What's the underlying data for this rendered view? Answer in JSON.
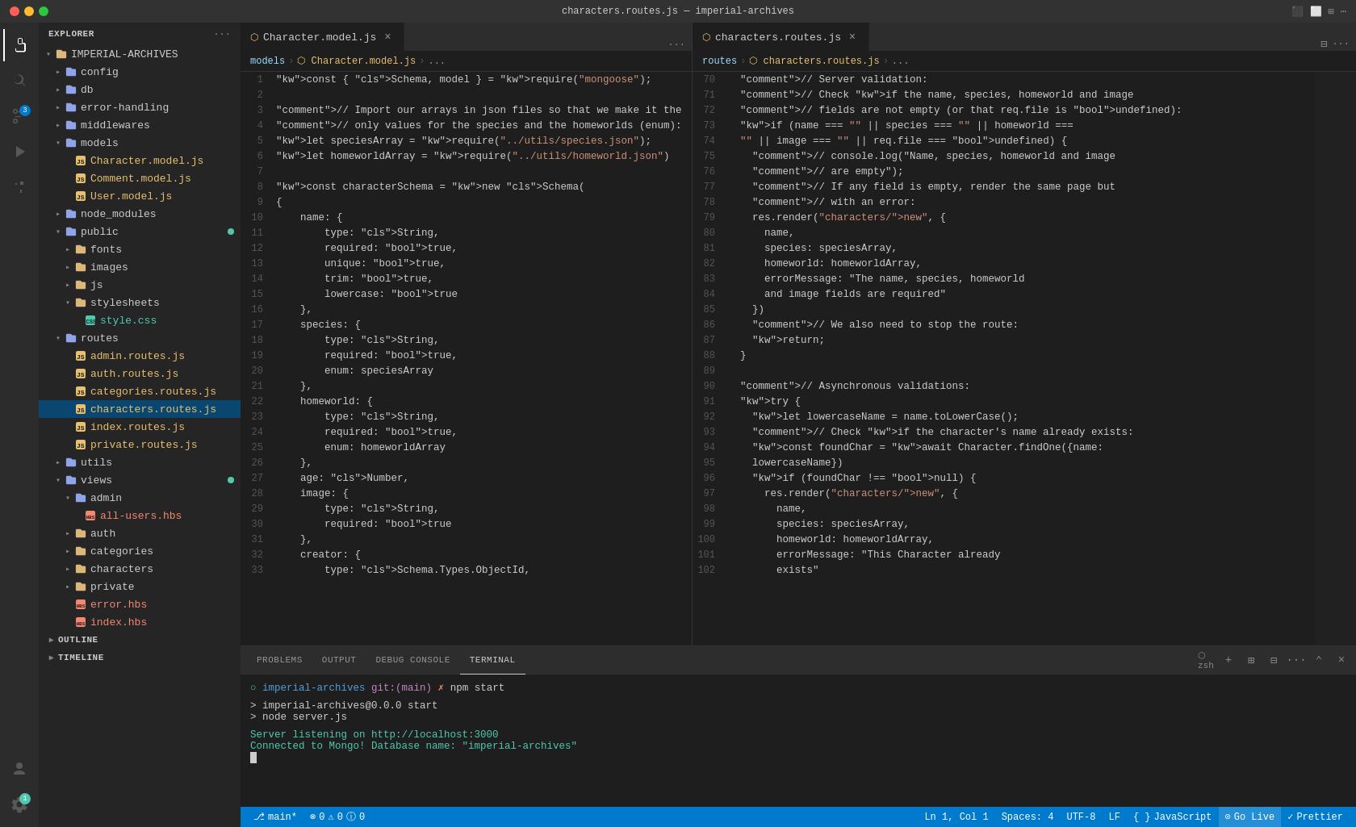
{
  "titleBar": {
    "title": "characters.routes.js — imperial-archives"
  },
  "activityBar": {
    "icons": [
      {
        "name": "explorer-icon",
        "symbol": "⎘",
        "active": true,
        "badge": null
      },
      {
        "name": "search-icon",
        "symbol": "🔍",
        "active": false,
        "badge": null
      },
      {
        "name": "source-control-icon",
        "symbol": "⎇",
        "active": false,
        "badge": "3"
      },
      {
        "name": "run-icon",
        "symbol": "▷",
        "active": false,
        "badge": null
      },
      {
        "name": "extensions-icon",
        "symbol": "⊞",
        "active": false,
        "badge": null
      }
    ],
    "bottomIcons": [
      {
        "name": "accounts-icon",
        "symbol": "👤"
      },
      {
        "name": "settings-icon",
        "symbol": "⚙",
        "badge": "1"
      }
    ]
  },
  "sidebar": {
    "title": "EXPLORER",
    "projectName": "IMPERIAL-ARCHIVES",
    "tree": [
      {
        "indent": 0,
        "type": "folder",
        "open": true,
        "label": "IMPERIAL-ARCHIVES",
        "color": "folder"
      },
      {
        "indent": 1,
        "type": "folder",
        "open": false,
        "label": "config",
        "color": "folder-blue"
      },
      {
        "indent": 1,
        "type": "folder",
        "open": false,
        "label": "db",
        "color": "folder-blue"
      },
      {
        "indent": 1,
        "type": "folder",
        "open": false,
        "label": "error-handling",
        "color": "folder-blue"
      },
      {
        "indent": 1,
        "type": "folder",
        "open": false,
        "label": "middlewares",
        "color": "folder-blue"
      },
      {
        "indent": 1,
        "type": "folder",
        "open": true,
        "label": "models",
        "color": "folder-blue"
      },
      {
        "indent": 2,
        "type": "file",
        "label": "Character.model.js",
        "color": "js"
      },
      {
        "indent": 2,
        "type": "file",
        "label": "Comment.model.js",
        "color": "js"
      },
      {
        "indent": 2,
        "type": "file",
        "label": "User.model.js",
        "color": "js"
      },
      {
        "indent": 1,
        "type": "folder",
        "open": false,
        "label": "node_modules",
        "color": "folder-blue"
      },
      {
        "indent": 1,
        "type": "folder",
        "open": true,
        "label": "public",
        "color": "folder-blue",
        "dot": true
      },
      {
        "indent": 2,
        "type": "folder",
        "open": false,
        "label": "fonts",
        "color": "folder"
      },
      {
        "indent": 2,
        "type": "folder",
        "open": false,
        "label": "images",
        "color": "folder"
      },
      {
        "indent": 2,
        "type": "folder",
        "open": false,
        "label": "js",
        "color": "folder"
      },
      {
        "indent": 2,
        "type": "folder",
        "open": true,
        "label": "stylesheets",
        "color": "folder"
      },
      {
        "indent": 3,
        "type": "file",
        "label": "style.css",
        "color": "css"
      },
      {
        "indent": 1,
        "type": "folder",
        "open": true,
        "label": "routes",
        "color": "folder-blue"
      },
      {
        "indent": 2,
        "type": "file",
        "label": "admin.routes.js",
        "color": "js"
      },
      {
        "indent": 2,
        "type": "file",
        "label": "auth.routes.js",
        "color": "js"
      },
      {
        "indent": 2,
        "type": "file",
        "label": "categories.routes.js",
        "color": "js"
      },
      {
        "indent": 2,
        "type": "file",
        "label": "characters.routes.js",
        "color": "js",
        "active": true
      },
      {
        "indent": 2,
        "type": "file",
        "label": "index.routes.js",
        "color": "js"
      },
      {
        "indent": 2,
        "type": "file",
        "label": "private.routes.js",
        "color": "js"
      },
      {
        "indent": 1,
        "type": "folder",
        "open": false,
        "label": "utils",
        "color": "folder-blue"
      },
      {
        "indent": 1,
        "type": "folder",
        "open": true,
        "label": "views",
        "color": "folder-blue",
        "dot": true
      },
      {
        "indent": 2,
        "type": "folder",
        "open": true,
        "label": "admin",
        "color": "folder-blue"
      },
      {
        "indent": 3,
        "type": "file",
        "label": "all-users.hbs",
        "color": "hbs"
      },
      {
        "indent": 2,
        "type": "folder",
        "open": false,
        "label": "auth",
        "color": "folder"
      },
      {
        "indent": 2,
        "type": "folder",
        "open": false,
        "label": "categories",
        "color": "folder"
      },
      {
        "indent": 2,
        "type": "folder",
        "open": false,
        "label": "characters",
        "color": "folder"
      },
      {
        "indent": 2,
        "type": "folder",
        "open": false,
        "label": "private",
        "color": "folder"
      },
      {
        "indent": 2,
        "type": "file",
        "label": "error.hbs",
        "color": "hbs"
      },
      {
        "indent": 2,
        "type": "file",
        "label": "index.hbs",
        "color": "hbs"
      }
    ],
    "outlineLabel": "OUTLINE",
    "timelineLabel": "TIMELINE"
  },
  "leftEditor": {
    "tab": {
      "icon": "js-icon",
      "label": "Character.model.js",
      "closable": true
    },
    "breadcrumb": [
      "models",
      "Character.model.js",
      "..."
    ],
    "lines": [
      {
        "num": 1,
        "code": "const { Schema, model } = require(\"mongoose\");"
      },
      {
        "num": 2,
        "code": ""
      },
      {
        "num": 3,
        "code": "// Import our arrays in json files so that we make it the"
      },
      {
        "num": 4,
        "code": "// only values for the species and the homeworlds (enum):"
      },
      {
        "num": 5,
        "code": "let speciesArray = require(\"../utils/species.json\");"
      },
      {
        "num": 6,
        "code": "let homeworldArray = require(\"../utils/homeworld.json\")"
      },
      {
        "num": 7,
        "code": ""
      },
      {
        "num": 8,
        "code": "const characterSchema = new Schema("
      },
      {
        "num": 9,
        "code": "{"
      },
      {
        "num": 10,
        "code": "    name: {"
      },
      {
        "num": 11,
        "code": "        type: String,"
      },
      {
        "num": 12,
        "code": "        required: true,"
      },
      {
        "num": 13,
        "code": "        unique: true,"
      },
      {
        "num": 14,
        "code": "        trim: true,"
      },
      {
        "num": 15,
        "code": "        lowercase: true"
      },
      {
        "num": 16,
        "code": "    },"
      },
      {
        "num": 17,
        "code": "    species: {"
      },
      {
        "num": 18,
        "code": "        type: String,"
      },
      {
        "num": 19,
        "code": "        required: true,"
      },
      {
        "num": 20,
        "code": "        enum: speciesArray"
      },
      {
        "num": 21,
        "code": "    },"
      },
      {
        "num": 22,
        "code": "    homeworld: {"
      },
      {
        "num": 23,
        "code": "        type: String,"
      },
      {
        "num": 24,
        "code": "        required: true,"
      },
      {
        "num": 25,
        "code": "        enum: homeworldArray"
      },
      {
        "num": 26,
        "code": "    },"
      },
      {
        "num": 27,
        "code": "    age: Number,"
      },
      {
        "num": 28,
        "code": "    image: {"
      },
      {
        "num": 29,
        "code": "        type: String,"
      },
      {
        "num": 30,
        "code": "        required: true"
      },
      {
        "num": 31,
        "code": "    },"
      },
      {
        "num": 32,
        "code": "    creator: {"
      },
      {
        "num": 33,
        "code": "        type: Schema.Types.ObjectId,"
      }
    ]
  },
  "rightEditor": {
    "tab": {
      "icon": "routes-icon",
      "label": "characters.routes.js",
      "closable": true
    },
    "breadcrumb": [
      "routes",
      "characters.routes.js",
      "..."
    ],
    "lines": [
      {
        "num": 70,
        "code": "  // Server validation:"
      },
      {
        "num": 71,
        "code": "  // Check if the name, species, homeworld and image"
      },
      {
        "num": 72,
        "code": "  // fields are not empty (or that req.file is undefined):"
      },
      {
        "num": 73,
        "code": "  if (name === \"\" || species === \"\" || homeworld ==="
      },
      {
        "num": 74,
        "code": "  \"\" || image === \"\" || req.file === undefined) {"
      },
      {
        "num": 75,
        "code": "    // console.log(\"Name, species, homeworld and image"
      },
      {
        "num": 76,
        "code": "    // are empty\");"
      },
      {
        "num": 77,
        "code": "    // If any field is empty, render the same page but"
      },
      {
        "num": 78,
        "code": "    // with an error:"
      },
      {
        "num": 79,
        "code": "    res.render(\"characters/new\", {"
      },
      {
        "num": 80,
        "code": "      name,"
      },
      {
        "num": 81,
        "code": "      species: speciesArray,"
      },
      {
        "num": 82,
        "code": "      homeworld: homeworldArray,"
      },
      {
        "num": 83,
        "code": "      errorMessage: \"The name, species, homeworld"
      },
      {
        "num": 84,
        "code": "      and image fields are required\""
      },
      {
        "num": 85,
        "code": "    })"
      },
      {
        "num": 86,
        "code": "    // We also need to stop the route:"
      },
      {
        "num": 87,
        "code": "    return;"
      },
      {
        "num": 88,
        "code": "  }"
      },
      {
        "num": 89,
        "code": ""
      },
      {
        "num": 90,
        "code": "  // Asynchronous validations:"
      },
      {
        "num": 91,
        "code": "  try {"
      },
      {
        "num": 92,
        "code": "    let lowercaseName = name.toLowerCase();"
      },
      {
        "num": 93,
        "code": "    // Check if the character's name already exists:"
      },
      {
        "num": 94,
        "code": "    const foundChar = await Character.findOne({name:"
      },
      {
        "num": 95,
        "code": "    lowercaseName})"
      },
      {
        "num": 96,
        "code": "    if (foundChar !== null) {"
      },
      {
        "num": 97,
        "code": "      res.render(\"characters/new\", {"
      },
      {
        "num": 98,
        "code": "        name,"
      },
      {
        "num": 99,
        "code": "        species: speciesArray,"
      },
      {
        "num": 100,
        "code": "        homeworld: homeworldArray,"
      },
      {
        "num": 101,
        "code": "        errorMessage: \"This Character already"
      },
      {
        "num": 102,
        "code": "        exists\""
      }
    ]
  },
  "panel": {
    "tabs": [
      "PROBLEMS",
      "OUTPUT",
      "DEBUG CONSOLE",
      "TERMINAL"
    ],
    "activeTab": "TERMINAL",
    "terminalContent": {
      "prompt": "imperial-archives git:(main) ✗",
      "command": "npm start",
      "output": [
        "",
        "> imperial-archives@0.0.0 start",
        "> node server.js",
        "",
        "Server listening on http://localhost:3000",
        "Connected to Mongo! Database name: \"imperial-archives\""
      ]
    }
  },
  "statusBar": {
    "branch": "main*",
    "errors": "0",
    "warnings": "0",
    "info": "0",
    "position": "Ln 1, Col 1",
    "spaces": "Spaces: 4",
    "encoding": "UTF-8",
    "lineEnding": "LF",
    "language": "JavaScript",
    "goLive": "Go Live",
    "prettier": "Prettier"
  }
}
